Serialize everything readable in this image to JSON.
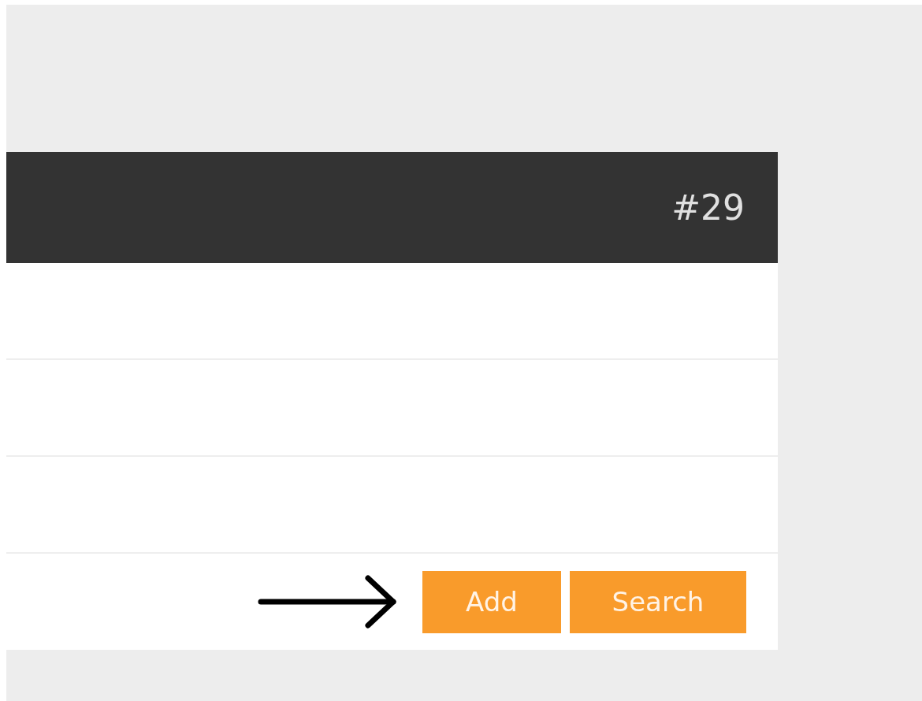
{
  "header": {
    "number": "#29"
  },
  "buttons": [
    "Add",
    "Search"
  ]
}
